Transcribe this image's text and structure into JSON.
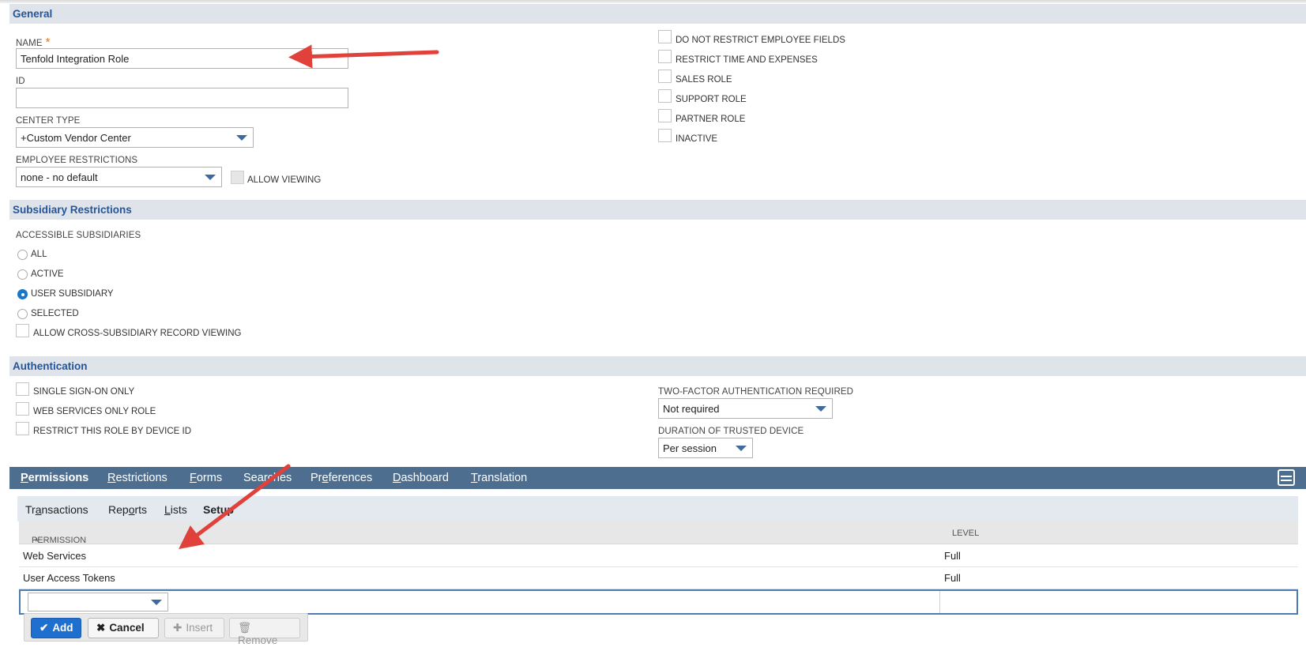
{
  "general": {
    "title": "General",
    "name_label": "NAME",
    "name_value": "Tenfold Integration Role",
    "id_label": "ID",
    "id_value": "",
    "center_type_label": "CENTER TYPE",
    "center_type_value": "+Custom Vendor Center",
    "employee_restrictions_label": "EMPLOYEE RESTRICTIONS",
    "employee_restrictions_value": "none - no default",
    "allow_viewing_label": "ALLOW VIEWING",
    "checkboxes": [
      {
        "label": "DO NOT RESTRICT EMPLOYEE FIELDS",
        "checked": false
      },
      {
        "label": "RESTRICT TIME AND EXPENSES",
        "checked": false
      },
      {
        "label": "SALES ROLE",
        "checked": false
      },
      {
        "label": "SUPPORT ROLE",
        "checked": false
      },
      {
        "label": "PARTNER ROLE",
        "checked": false
      },
      {
        "label": "INACTIVE",
        "checked": false
      }
    ]
  },
  "subsidiary": {
    "title": "Subsidiary Restrictions",
    "accessible_label": "ACCESSIBLE SUBSIDIARIES",
    "options": [
      "ALL",
      "ACTIVE",
      "USER SUBSIDIARY",
      "SELECTED"
    ],
    "selected": "USER SUBSIDIARY",
    "cross_label": "ALLOW CROSS-SUBSIDIARY RECORD VIEWING"
  },
  "authentication": {
    "title": "Authentication",
    "checkboxes": [
      "SINGLE SIGN-ON ONLY",
      "WEB SERVICES ONLY ROLE",
      "RESTRICT THIS ROLE BY DEVICE ID"
    ],
    "two_factor_label": "TWO-FACTOR AUTHENTICATION REQUIRED",
    "two_factor_value": "Not required",
    "duration_label": "DURATION OF TRUSTED DEVICE",
    "duration_value": "Per session"
  },
  "tabs": [
    {
      "pre": "",
      "u": "P",
      "post": "ermissions"
    },
    {
      "pre": "",
      "u": "R",
      "post": "estrictions"
    },
    {
      "pre": "",
      "u": "F",
      "post": "orms"
    },
    {
      "pre": "Sea",
      "u": "r",
      "post": "ches"
    },
    {
      "pre": "Pr",
      "u": "e",
      "post": "ferences"
    },
    {
      "pre": "",
      "u": "D",
      "post": "ashboard"
    },
    {
      "pre": "",
      "u": "T",
      "post": "ranslation"
    }
  ],
  "subtabs": [
    {
      "pre": "Tr",
      "u": "a",
      "post": "nsactions"
    },
    {
      "pre": "Rep",
      "u": "o",
      "post": "rts"
    },
    {
      "pre": "",
      "u": "L",
      "post": "ists"
    },
    {
      "pre": "",
      "u": "",
      "post": "Setup"
    }
  ],
  "table": {
    "col_permission": "PERMISSION",
    "col_level": "LEVEL",
    "rows": [
      {
        "permission": "Web Services",
        "level": "Full"
      },
      {
        "permission": "User Access Tokens",
        "level": "Full"
      }
    ]
  },
  "buttons": {
    "add": "Add",
    "cancel": "Cancel",
    "insert": "Insert",
    "remove": "Remove"
  },
  "colors": {
    "section_bg": "#dfe4eb",
    "section_title": "#255599",
    "tabbar": "#4d6e8f",
    "accent": "#1f6fcf",
    "required": "#e2772b",
    "arrow": "#e0413a"
  }
}
